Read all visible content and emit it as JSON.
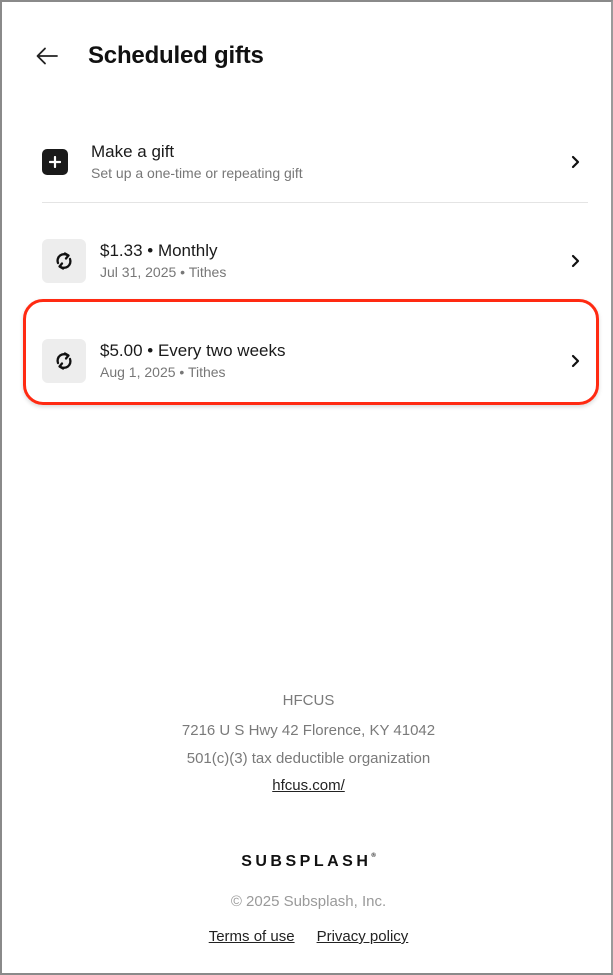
{
  "header": {
    "title": "Scheduled gifts",
    "back_icon": "arrow-left-icon"
  },
  "make_gift": {
    "title": "Make a gift",
    "subtitle": "Set up a one-time or repeating gift",
    "icon": "plus-icon"
  },
  "scheduled_gifts": [
    {
      "title": "$1.33 • Monthly",
      "subtitle": "Jul 31, 2025 • Tithes",
      "icon": "repeat-icon"
    },
    {
      "title": "$5.00 • Every two weeks",
      "subtitle": "Aug 1, 2025 • Tithes",
      "icon": "repeat-icon",
      "highlighted": true
    }
  ],
  "organization": {
    "name": "HFCUS",
    "address": "7216 U S Hwy 42 Florence, KY 41042",
    "status": "501(c)(3) tax deductible organization",
    "website": "hfcus.com/"
  },
  "footer": {
    "brand": "SUBSPLASH",
    "copyright": "© 2025 Subsplash, Inc.",
    "terms_label": "Terms of use",
    "privacy_label": "Privacy policy"
  },
  "colors": {
    "highlight": "#ff2a12",
    "icon_bg": "#ededed",
    "plus_bg": "#1a1a1a"
  }
}
